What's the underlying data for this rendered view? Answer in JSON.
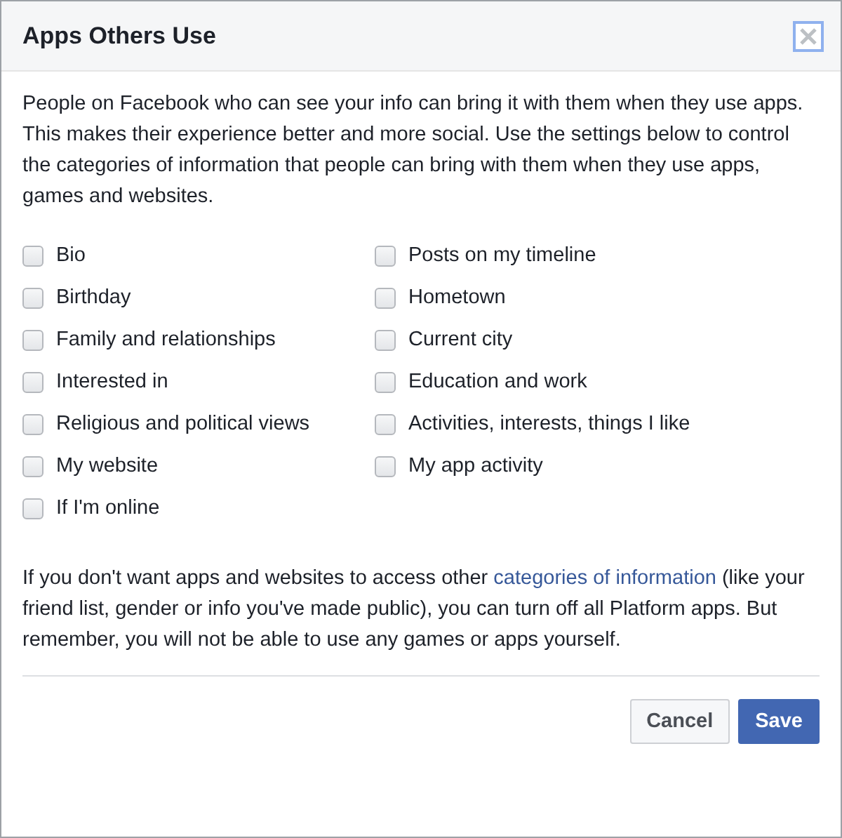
{
  "dialog": {
    "title": "Apps Others Use"
  },
  "intro": "People on Facebook who can see your info can bring it with them when they use apps. This makes their experience better and more social. Use the settings below to control the categories of information that people can bring with them when they use apps, games and websites.",
  "columns": [
    [
      {
        "label": "Bio",
        "checked": false
      },
      {
        "label": "Birthday",
        "checked": false
      },
      {
        "label": "Family and relationships",
        "checked": false
      },
      {
        "label": "Interested in",
        "checked": false
      },
      {
        "label": "Religious and political views",
        "checked": false
      },
      {
        "label": "My website",
        "checked": false
      },
      {
        "label": "If I'm online",
        "checked": false
      }
    ],
    [
      {
        "label": "Posts on my timeline",
        "checked": false
      },
      {
        "label": "Hometown",
        "checked": false
      },
      {
        "label": "Current city",
        "checked": false
      },
      {
        "label": "Education and work",
        "checked": false
      },
      {
        "label": "Activities, interests, things I like",
        "checked": false
      },
      {
        "label": "My app activity",
        "checked": false
      }
    ]
  ],
  "note": {
    "before": "If you don't want apps and websites to access other",
    "link": "categories of information",
    "after": "(like your friend list, gender or info you've made public), you can turn off all Platform apps. But remember, you will not be able to use any games or apps yourself."
  },
  "buttons": [
    {
      "label": "Cancel",
      "kind": "secondary"
    },
    {
      "label": "Save",
      "kind": "primary"
    }
  ]
}
